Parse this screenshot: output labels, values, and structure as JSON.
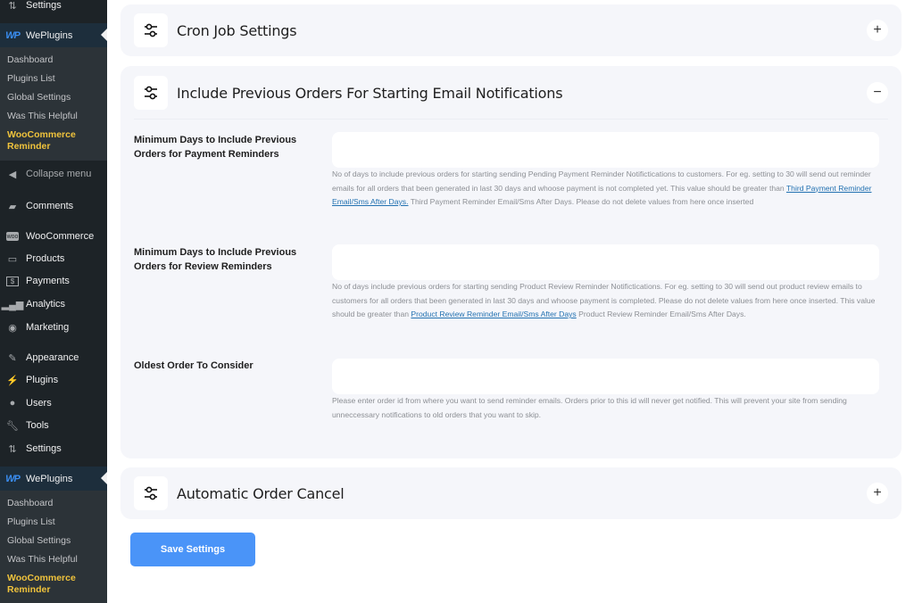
{
  "sidebar": {
    "top_settings": "Settings",
    "weplugins_1": {
      "label": "WePlugins",
      "logo": "WP",
      "items": [
        "Dashboard",
        "Plugins List",
        "Global Settings",
        "Was This Helpful"
      ],
      "current": "WooCommerce Reminder"
    },
    "collapse": "Collapse menu",
    "comments": "Comments",
    "woocommerce": "WooCommerce",
    "products": "Products",
    "payments": "Payments",
    "analytics": "Analytics",
    "marketing": "Marketing",
    "appearance": "Appearance",
    "plugins": "Plugins",
    "users": "Users",
    "tools": "Tools",
    "settings": "Settings",
    "weplugins_2": {
      "label": "WePlugins",
      "logo": "WP",
      "items": [
        "Dashboard",
        "Plugins List",
        "Global Settings",
        "Was This Helpful"
      ],
      "current": "WooCommerce Reminder"
    }
  },
  "panels": {
    "cron": {
      "title": "Cron Job Settings",
      "toggle": "+"
    },
    "previous": {
      "title": "Include Previous Orders For Starting Email Notifications",
      "toggle": "−",
      "fields": [
        {
          "label": "Minimum Days to Include Previous Orders for Payment Reminders",
          "value": "",
          "help_before": "No of days to include previous orders for starting sending Pending Payment Reminder Notifictications to customers. For eg. setting to 30 will send out reminder emails for all orders that been generated in last 30 days and whoose payment is not completed yet. This value should be greater than ",
          "help_link": "Third Payment Reminder Email/Sms After Days.",
          "help_after": " Third Payment Reminder Email/Sms After Days. Please do not delete values from here once inserted"
        },
        {
          "label": "Minimum Days to Include Previous Orders for Review Reminders",
          "value": "",
          "help_before": "No of days include previous orders for starting sending Product Review Reminder Notifictications. For eg. setting to 30 will send out product review emails to customers for all orders that been generated in last 30 days and whoose payment is completed. Please do not delete values from here once inserted. This value should be greater than ",
          "help_link": "Product Review Reminder Email/Sms After Days",
          "help_after": " Product Review Reminder Email/Sms After Days."
        },
        {
          "label": "Oldest Order To Consider",
          "value": "",
          "help_before": "Please enter order id from where you want to send reminder emails. Orders prior to this id will never get notified. This will prevent your site from sending unneccessary notifications to old orders that you want to skip.",
          "help_link": "",
          "help_after": ""
        }
      ]
    },
    "cancel": {
      "title": "Automatic Order Cancel",
      "toggle": "+"
    }
  },
  "save_button": "Save Settings",
  "colors": {
    "sidebar_bg": "#1d2327",
    "submenu_bg": "#2c3338",
    "current_item": "#f0c33c",
    "brand_blue": "#3a8df0",
    "panel_bg": "#f5f6fa",
    "save_button": "#4a94f8",
    "link": "#2271b1"
  }
}
